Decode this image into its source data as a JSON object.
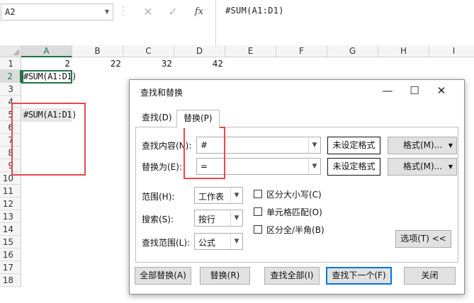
{
  "formula_bar": {
    "name_box": "A2",
    "cancel_icon": "✕",
    "enter_icon": "✓",
    "function_icon": "fx",
    "formula": "#SUM(A1:D1)"
  },
  "sheet": {
    "columns": [
      "A",
      "B",
      "C",
      "D",
      "E",
      "F",
      "G",
      "H",
      "I"
    ],
    "rows": [
      "1",
      "2",
      "3",
      "4",
      "5",
      "6",
      "7",
      "8",
      "9",
      "10",
      "11",
      "12",
      "13",
      "14",
      "15",
      "16",
      "17",
      "18"
    ],
    "cells": {
      "A1": "2",
      "B1": "22",
      "C1": "32",
      "D1": "42",
      "A2": "#SUM(A1:D1)",
      "A5": "#SUM(A1:D1)"
    },
    "active_cell": "A2"
  },
  "dialog": {
    "title": "查找和替换",
    "controls": {
      "minimize": "—",
      "maximize": "☐",
      "close": "✕"
    },
    "tabs": [
      "查找(D)",
      "替换(P)"
    ],
    "active_tab": "替换(P)",
    "find_label": "查找内容(N):",
    "find_value": "#",
    "replace_label": "替换为(E):",
    "replace_value": "=",
    "no_format_label": "未设定格式",
    "format_button": "格式(M)...",
    "scope_label": "范围(H):",
    "scope_value": "工作表",
    "search_label": "搜索(S):",
    "search_value": "按行",
    "lookin_label": "查找范围(L):",
    "lookin_value": "公式",
    "match_case": {
      "label": "区分大小写(C)",
      "checked": false
    },
    "match_entire": {
      "label": "单元格匹配(O)",
      "checked": false
    },
    "match_width": {
      "label": "区分全/半角(B)",
      "checked": false
    },
    "options_button": "选项(T) <<",
    "buttons": {
      "replace_all": "全部替换(A)",
      "replace": "替换(R)",
      "find_all": "查找全部(I)",
      "find_next": "查找下一个(F)",
      "close": "关闭"
    }
  },
  "colors": {
    "accent_green": "#217346",
    "annotation_red": "#e5484d",
    "default_button_blue": "#0078d7"
  }
}
